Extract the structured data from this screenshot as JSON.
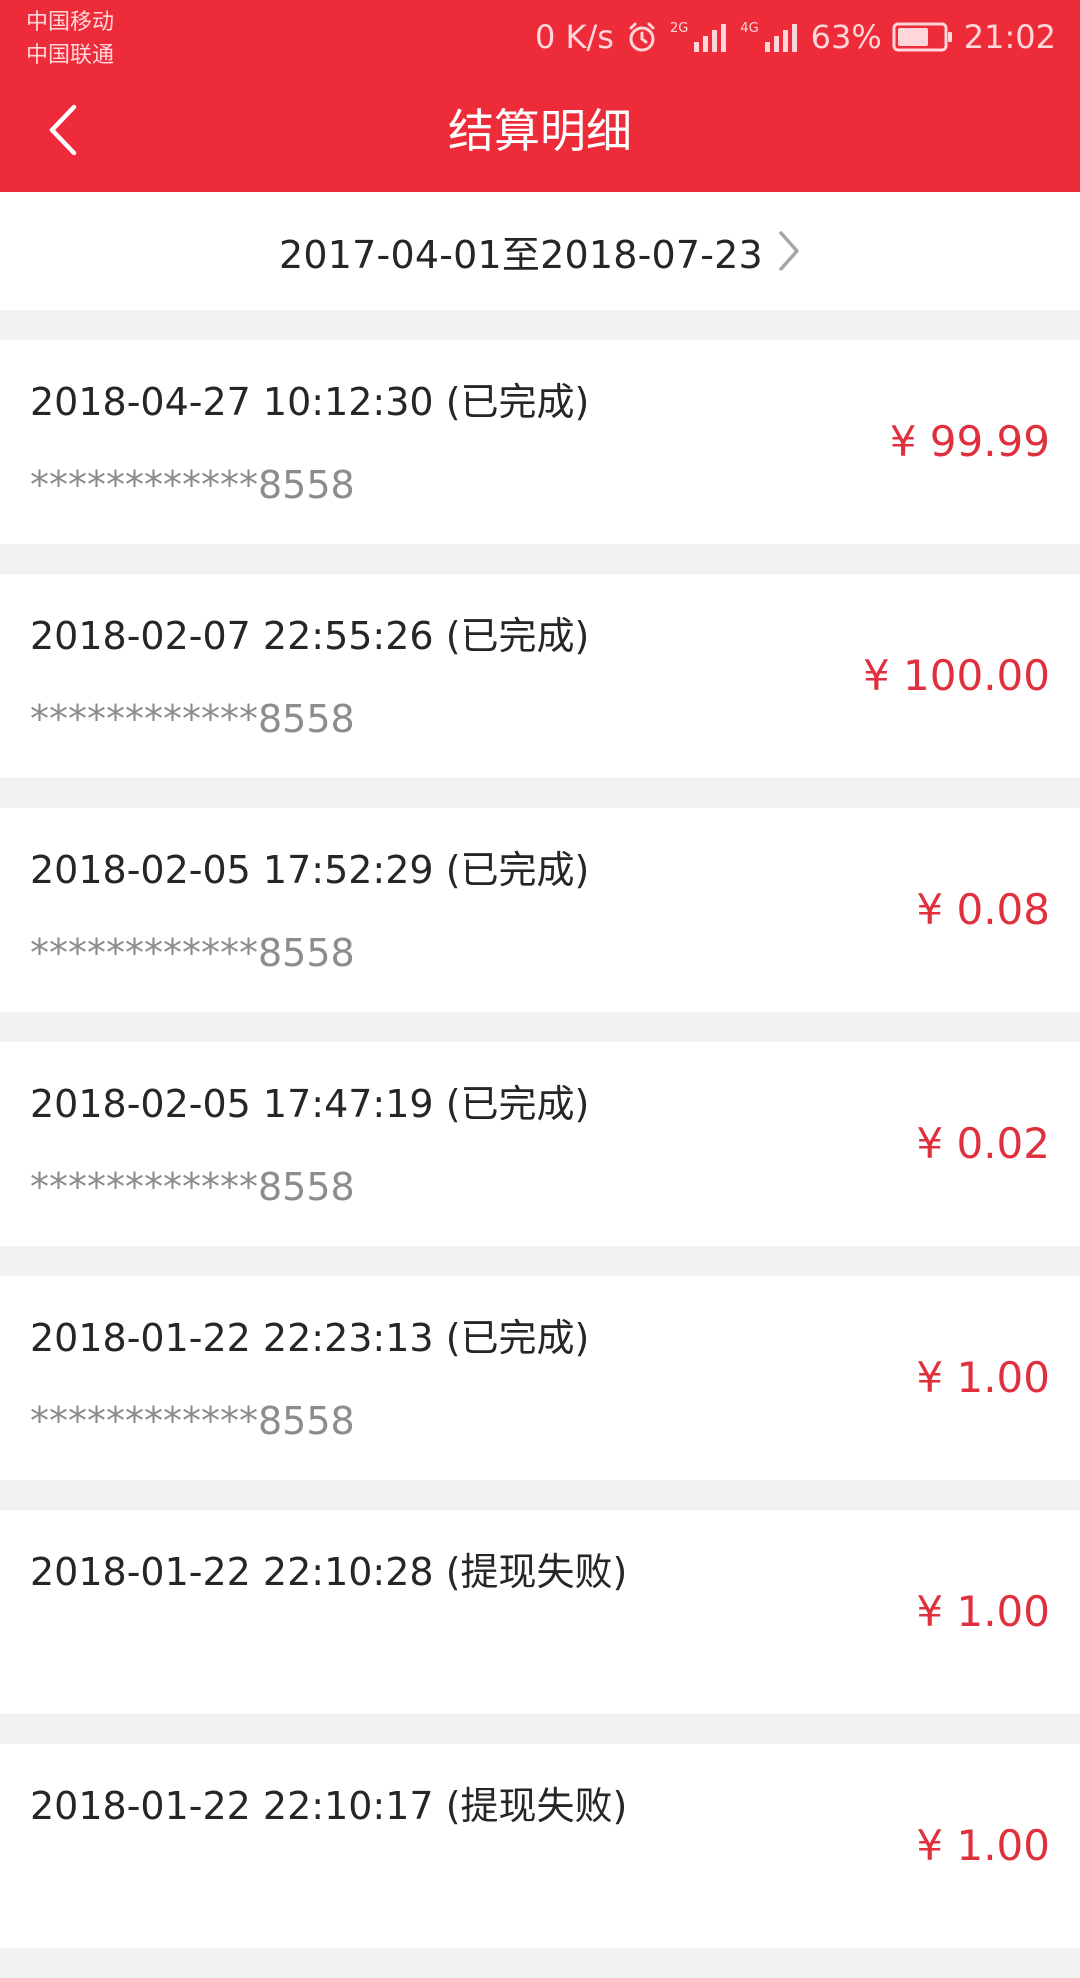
{
  "status_bar": {
    "carrier_1": "中国移动",
    "carrier_2": "中国联通",
    "net_speed": "0 K/s",
    "sim1_type": "2G",
    "sim2_type": "4G",
    "battery_percent": "63%",
    "time": "21:02"
  },
  "header": {
    "title": "结算明细"
  },
  "date_range": {
    "label": "2017-04-01至2018-07-23"
  },
  "records": [
    {
      "datetime": "2018-04-27 10:12:30",
      "status": "(已完成)",
      "card": "************8558",
      "amount": "¥ 99.99"
    },
    {
      "datetime": "2018-02-07 22:55:26",
      "status": "(已完成)",
      "card": "************8558",
      "amount": "¥ 100.00"
    },
    {
      "datetime": "2018-02-05 17:52:29",
      "status": "(已完成)",
      "card": "************8558",
      "amount": "¥ 0.08"
    },
    {
      "datetime": "2018-02-05 17:47:19",
      "status": "(已完成)",
      "card": "************8558",
      "amount": "¥ 0.02"
    },
    {
      "datetime": "2018-01-22 22:23:13",
      "status": "(已完成)",
      "card": "************8558",
      "amount": "¥ 1.00"
    },
    {
      "datetime": "2018-01-22 22:10:28",
      "status": "(提现失败)",
      "card": "",
      "amount": "¥ 1.00"
    },
    {
      "datetime": "2018-01-22 22:10:17",
      "status": "(提现失败)",
      "card": "",
      "amount": "¥ 1.00"
    }
  ],
  "colors": {
    "brand_red": "#ee2b38",
    "amount_red": "#e0303d",
    "background": "#f2f2f2"
  },
  "icons": {
    "back": "back-arrow-icon",
    "chevron": "chevron-right-icon",
    "alarm": "alarm-icon",
    "signal": "signal-icon",
    "battery": "battery-icon"
  }
}
